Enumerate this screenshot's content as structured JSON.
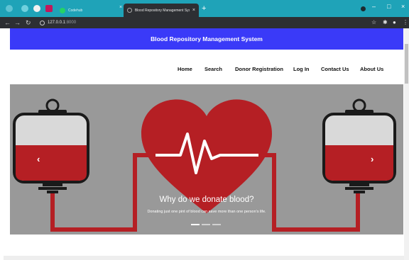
{
  "browser": {
    "tabs": [
      {
        "label": "Codehub"
      },
      {
        "label": "Blood Repository Management Sys"
      }
    ],
    "url": "127.0.0.1",
    "url_port": ":8000"
  },
  "site": {
    "banner_title": "Blood Repository Management System",
    "nav": [
      {
        "label": "Home"
      },
      {
        "label": "Search"
      },
      {
        "label": "Donor Registration"
      },
      {
        "label": "Log In"
      },
      {
        "label": "Contact Us"
      },
      {
        "label": "About Us"
      }
    ]
  },
  "carousel": {
    "caption_title": "Why do we donate blood?",
    "caption_text": "Donating just one pint of blood can save more than one person's life.",
    "prev_glyph": "‹",
    "next_glyph": "›",
    "active_index": 0,
    "slide_count": 3
  },
  "colors": {
    "tabbar": "#1fa3b8",
    "banner": "#3a3af8",
    "blood": "#b51f24",
    "carousel_bg": "#999999"
  }
}
